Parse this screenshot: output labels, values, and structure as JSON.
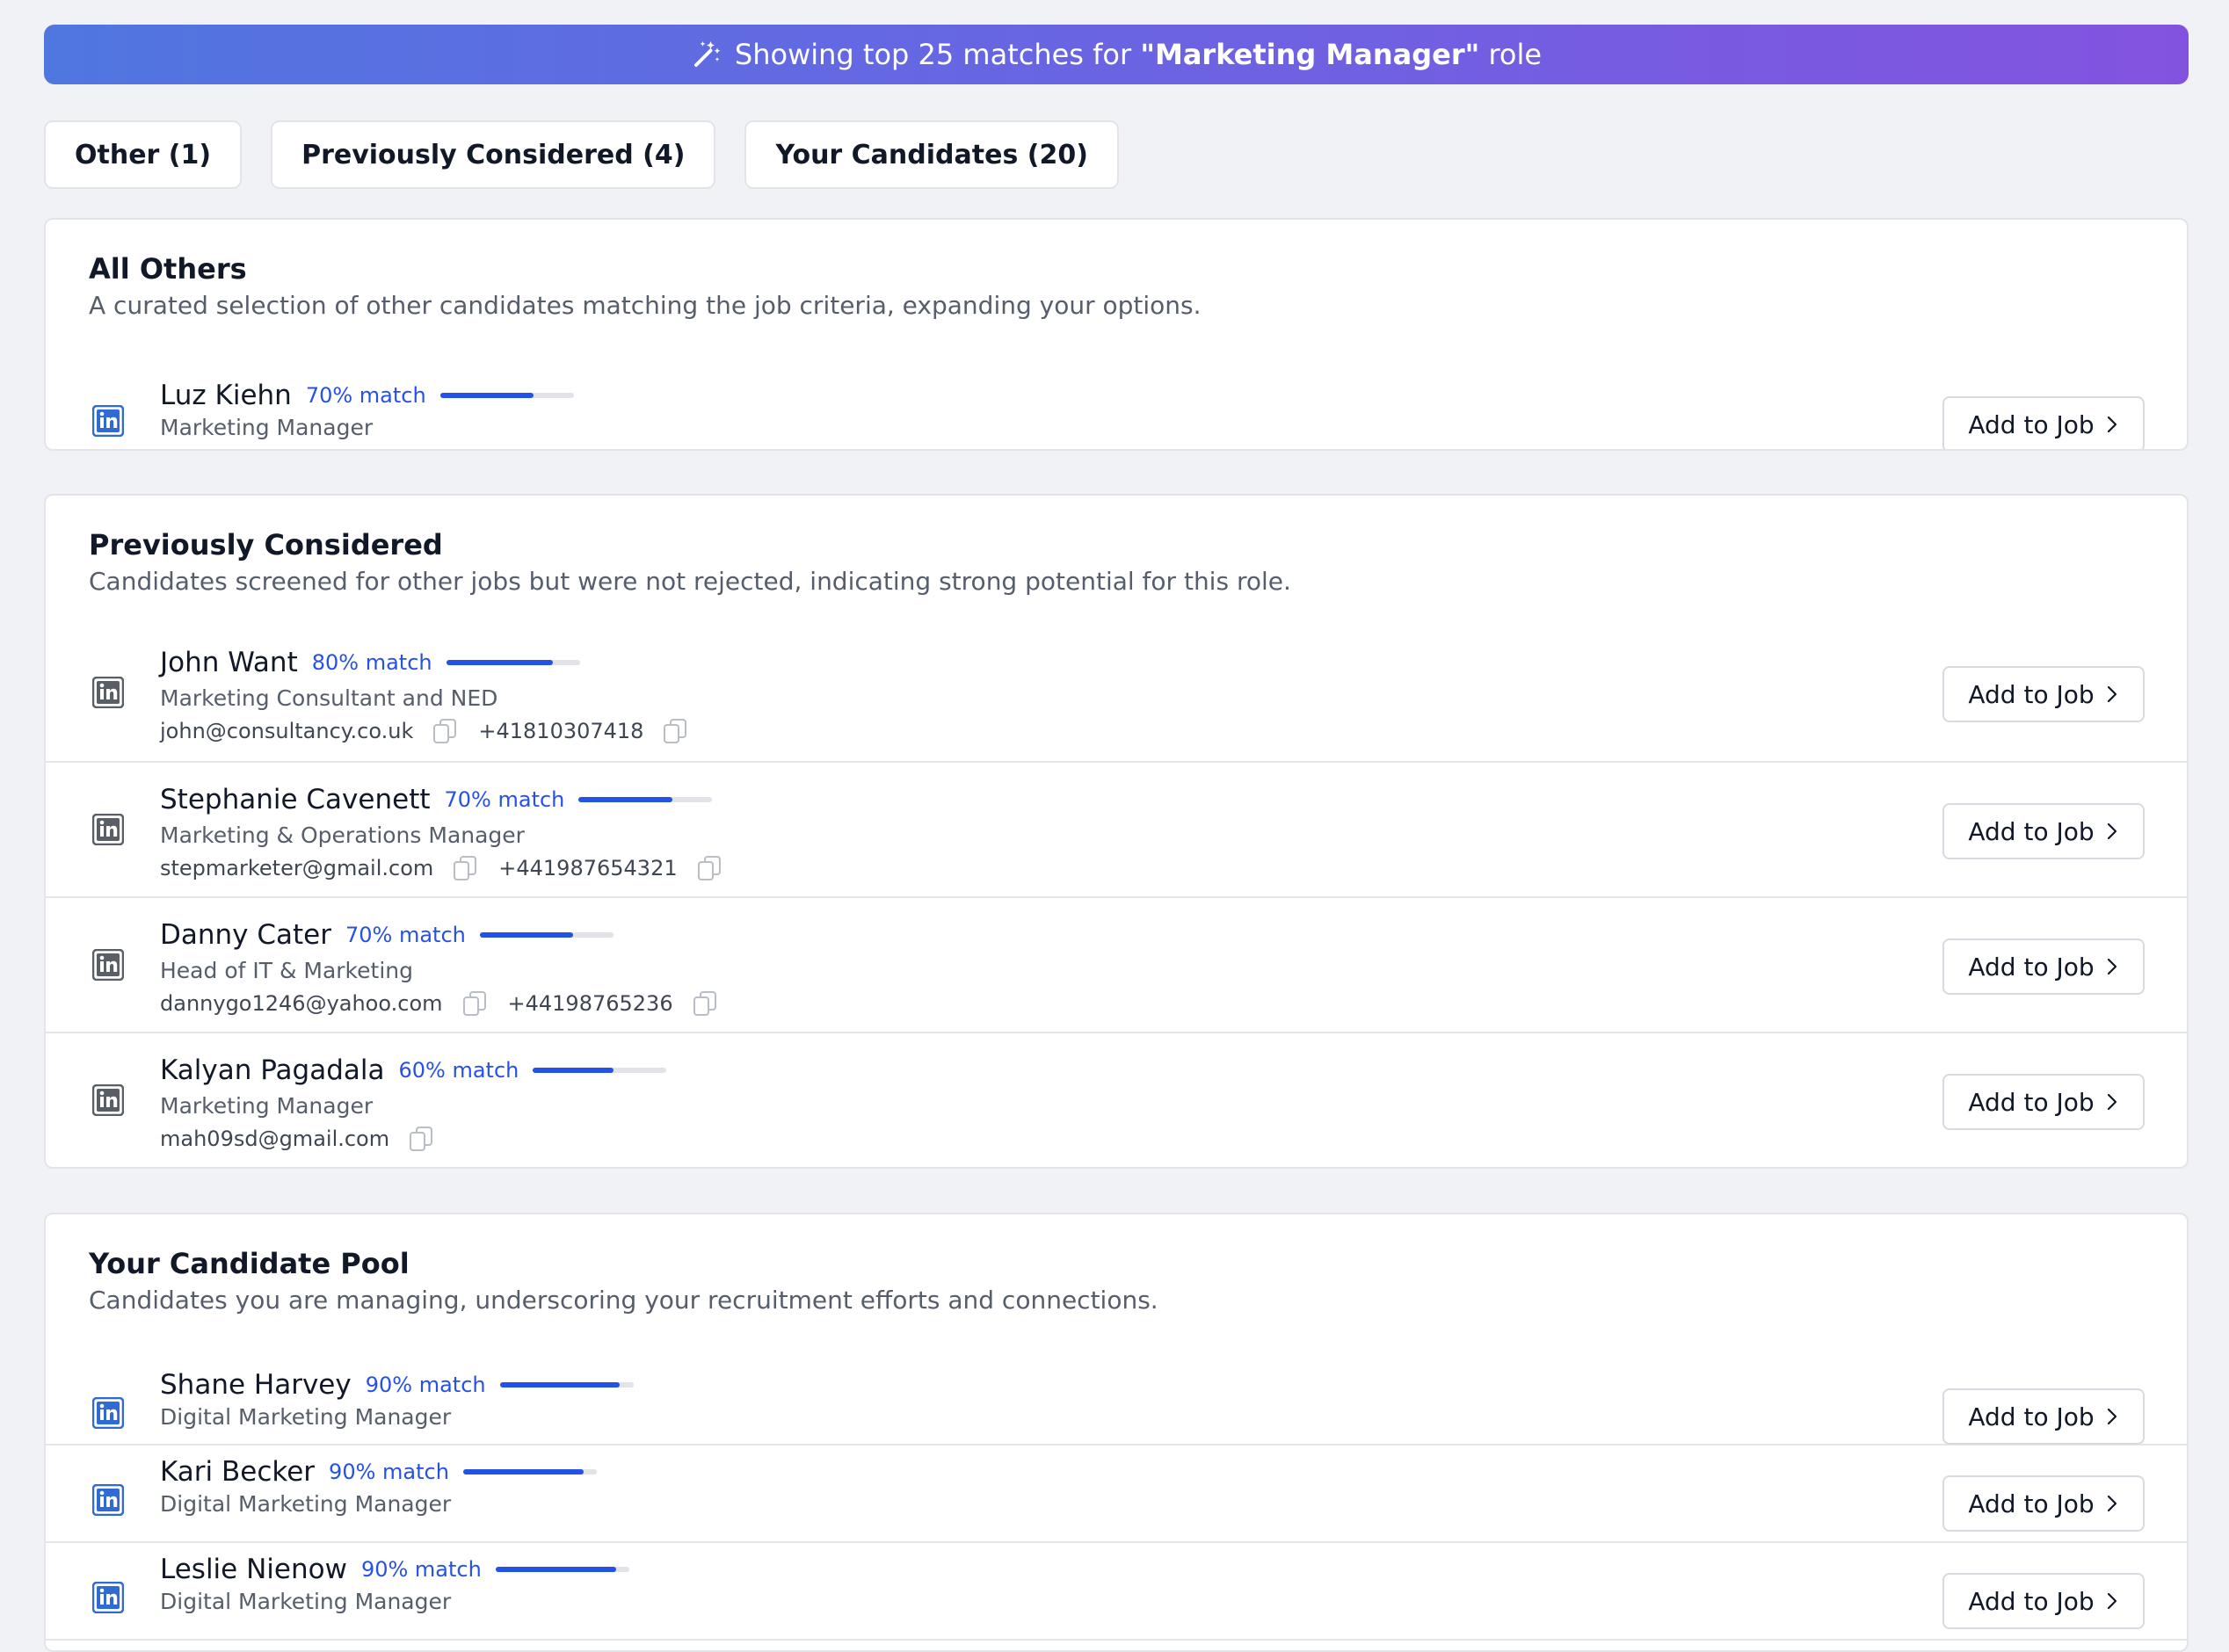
{
  "banner": {
    "prefix": "Showing top 25 matches for ",
    "role": "\"Marketing Manager\"",
    "suffix": " role",
    "icon": "magic-wand-icon"
  },
  "tabs": [
    {
      "label": "Other (1)"
    },
    {
      "label": "Previously Considered (4)"
    },
    {
      "label": "Your Candidates (20)"
    }
  ],
  "add_to_job_label": "Add to Job",
  "sections": {
    "others": {
      "title": "All Others",
      "description": "A curated selection of other candidates matching the job criteria, expanding your options.",
      "candidates": [
        {
          "name": "Luz Kiehn",
          "match": "70% match",
          "match_fraction": 0.7,
          "title": "Marketing Manager"
        }
      ]
    },
    "previously": {
      "title": "Previously Considered",
      "description": "Candidates screened for other jobs but were not rejected, indicating strong potential for this role.",
      "candidates": [
        {
          "name": "John Want",
          "match": "80% match",
          "match_fraction": 0.8,
          "title": "Marketing Consultant and NED",
          "email": "john@consultancy.co.uk",
          "phone": "+41810307418"
        },
        {
          "name": "Stephanie Cavenett",
          "match": "70% match",
          "match_fraction": 0.7,
          "title": "Marketing & Operations Manager",
          "email": "stepmarketer@gmail.com",
          "phone": "+441987654321"
        },
        {
          "name": "Danny Cater",
          "match": "70% match",
          "match_fraction": 0.7,
          "title": "Head of IT & Marketing",
          "email": "dannygo1246@yahoo.com",
          "phone": "+44198765236"
        },
        {
          "name": "Kalyan Pagadala",
          "match": "60% match",
          "match_fraction": 0.6,
          "title": "Marketing Manager",
          "email": "mah09sd@gmail.com"
        }
      ]
    },
    "pool": {
      "title": "Your Candidate Pool",
      "description": "Candidates you are managing, underscoring your recruitment efforts and connections.",
      "candidates": [
        {
          "name": "Shane Harvey",
          "match": "90% match",
          "match_fraction": 0.9,
          "title": "Digital Marketing Manager"
        },
        {
          "name": "Kari Becker",
          "match": "90% match",
          "match_fraction": 0.9,
          "title": "Digital Marketing Manager"
        },
        {
          "name": "Leslie Nienow",
          "match": "90% match",
          "match_fraction": 0.9,
          "title": "Digital Marketing Manager"
        }
      ]
    }
  },
  "colors": {
    "accent": "#2452e6",
    "linkedin_active": "#2f6bd3",
    "linkedin_inactive": "#5a5f67",
    "banner_start": "#5076e0",
    "banner_end": "#8353e0"
  },
  "icons": {
    "linkedin": "linkedin-icon",
    "copy": "copy-icon",
    "chevron": "chevron-right-icon"
  }
}
